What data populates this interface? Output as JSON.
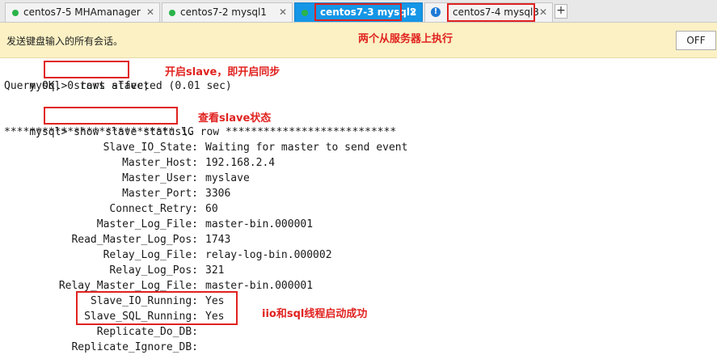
{
  "tabs": [
    {
      "label": "centos7-5 MHAmanager",
      "status_color": "#2bb44a",
      "close": "✕"
    },
    {
      "label": "centos7-2 mysql1",
      "status_color": "#2bb44a",
      "close": "✕"
    },
    {
      "label": "centos7-3 mysql2",
      "status_color": "#2bb44a",
      "close": "✕",
      "active": true
    },
    {
      "label": "centos7-4 mysql3",
      "status_icon": "!",
      "close": "✕"
    }
  ],
  "add_tab": "+",
  "notification": {
    "text": "发送键盘输入的所有会话。",
    "note": "两个从服务器上执行",
    "button_label": "OFF"
  },
  "terminal": {
    "prompt1": "mysql>",
    "cmd1": " start slave;",
    "note1": "开启slave，即开启同步",
    "result1": "Query OK, 0 rows affected (0.01 sec)",
    "prompt2": "mysql>",
    "cmd2": " show slave status\\G",
    "note2": "查看slave状态",
    "row_header": "*************************** 1. row ***************************",
    "fields": [
      {
        "name": "Slave_IO_State:",
        "value": "Waiting for master to send event"
      },
      {
        "name": "Master_Host:",
        "value": "192.168.2.4"
      },
      {
        "name": "Master_User:",
        "value": "myslave"
      },
      {
        "name": "Master_Port:",
        "value": "3306"
      },
      {
        "name": "Connect_Retry:",
        "value": "60"
      },
      {
        "name": "Master_Log_File:",
        "value": "master-bin.000001"
      },
      {
        "name": "Read_Master_Log_Pos:",
        "value": "1743"
      },
      {
        "name": "Relay_Log_File:",
        "value": "relay-log-bin.000002"
      },
      {
        "name": "Relay_Log_Pos:",
        "value": "321"
      },
      {
        "name": "Relay_Master_Log_File:",
        "value": "master-bin.000001"
      },
      {
        "name": "Slave_IO_Running:",
        "value": "Yes"
      },
      {
        "name": "Slave_SQL_Running:",
        "value": "Yes"
      },
      {
        "name": "Replicate_Do_DB:",
        "value": ""
      },
      {
        "name": "Replicate_Ignore_DB:",
        "value": ""
      }
    ],
    "note3": "iio和sql线程启动成功"
  }
}
